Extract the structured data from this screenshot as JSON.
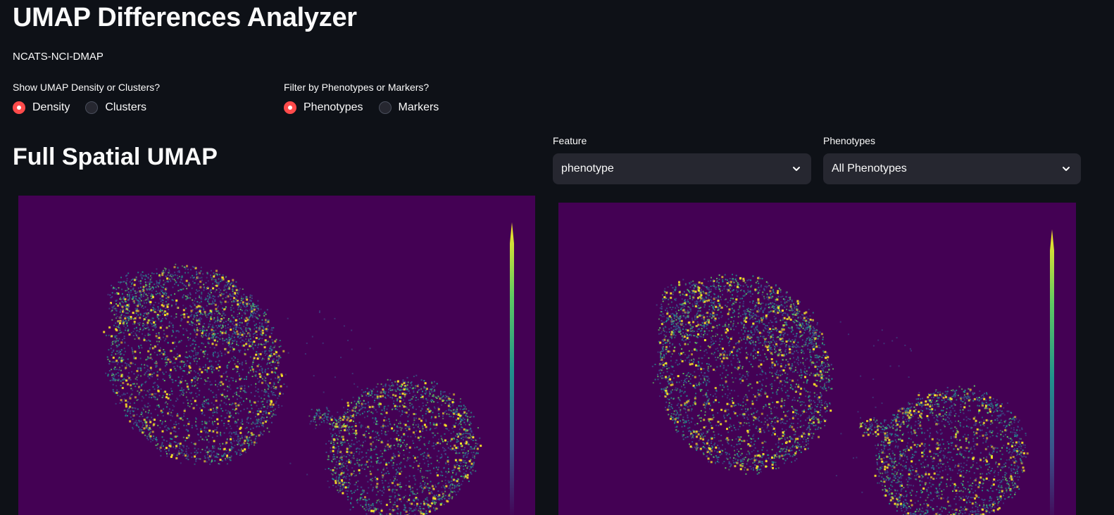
{
  "app": {
    "title": "UMAP Differences Analyzer",
    "subtitle": "NCATS-NCI-DMAP"
  },
  "density_toggle": {
    "label": "Show UMAP Density or Clusters?",
    "options": [
      "Density",
      "Clusters"
    ],
    "selected": "Density"
  },
  "filter_toggle": {
    "label": "Filter by Phenotypes or Markers?",
    "options": [
      "Phenotypes",
      "Markers"
    ],
    "selected": "Phenotypes"
  },
  "section": {
    "title": "Full Spatial UMAP"
  },
  "feature_select": {
    "label": "Feature",
    "value": "phenotype"
  },
  "phenotypes_select": {
    "label": "Phenotypes",
    "value": "All Phenotypes"
  },
  "colors": {
    "background": "#0e1117",
    "widget": "#262730",
    "accent": "#ff4b4b",
    "plot_background": "#440154",
    "colormap": [
      "#440154",
      "#3b528b",
      "#21918c",
      "#5ec962",
      "#fde725"
    ]
  },
  "plots": [
    {
      "name": "full-spatial-umap-density",
      "colormap": "viridis"
    },
    {
      "name": "filtered-umap-density",
      "colormap": "viridis"
    }
  ]
}
